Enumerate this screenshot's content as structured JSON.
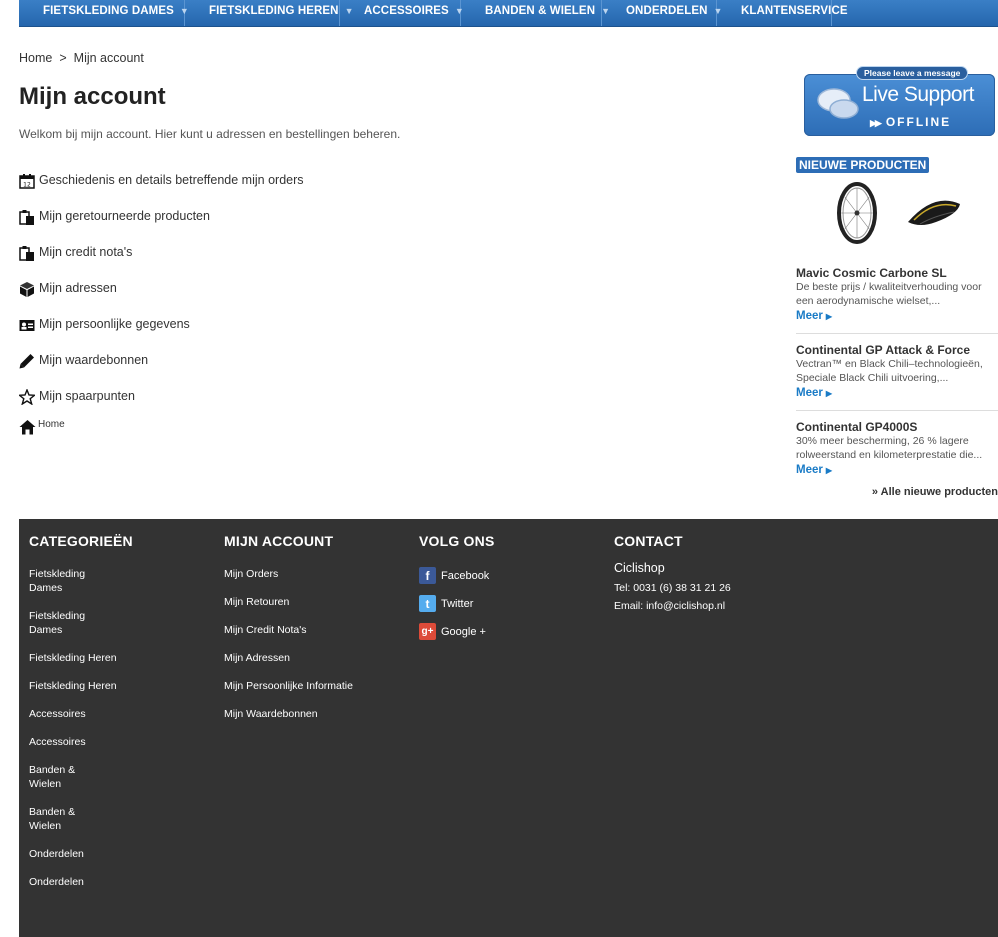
{
  "nav": {
    "items": [
      {
        "label": "FIETSKLEDING DAMES",
        "dropdown": true
      },
      {
        "label": "FIETSKLEDING HEREN",
        "dropdown": true
      },
      {
        "label": "ACCESSOIRES",
        "dropdown": true
      },
      {
        "label": "BANDEN & WIELEN",
        "dropdown": true
      },
      {
        "label": "ONDERDELEN",
        "dropdown": true
      },
      {
        "label": "KLANTENSERVICE",
        "dropdown": false
      }
    ]
  },
  "breadcrumb": {
    "home": "Home",
    "separator": ">",
    "current": "Mijn account"
  },
  "page": {
    "title": "Mijn account",
    "intro": "Welkom bij mijn account. Hier kunt u adressen en bestellingen beheren."
  },
  "account_links": [
    {
      "label": "Geschiedenis en details betreffende mijn orders",
      "icon": "calendar-icon"
    },
    {
      "label": "Mijn geretourneerde producten",
      "icon": "clipboard-icon"
    },
    {
      "label": "Mijn credit nota's",
      "icon": "clipboard-icon"
    },
    {
      "label": "Mijn adressen",
      "icon": "box-icon"
    },
    {
      "label": "Mijn persoonlijke gegevens",
      "icon": "id-card-icon"
    },
    {
      "label": "Mijn waardebonnen",
      "icon": "pencil-icon"
    },
    {
      "label": "Mijn spaarpunten",
      "icon": "star-icon"
    }
  ],
  "home_link": {
    "label": "Home",
    "icon": "home-icon"
  },
  "live_support": {
    "message": "Please leave a message",
    "title": "Live Support",
    "status": "OFFLINE"
  },
  "new_products": {
    "badge": "NIEUWE PRODUCTEN",
    "items": [
      {
        "name": "Mavic Cosmic Carbone SL",
        "desc": "De beste prijs / kwaliteitverhouding voor een aerodynamische wielset,...",
        "more": "Meer"
      },
      {
        "name": "Continental GP Attack & Force",
        "desc": "Vectran™ en Black Chili–technologieën, Speciale Black Chili uitvoering,...",
        "more": "Meer"
      },
      {
        "name": "Continental GP4000S",
        "desc": "30% meer bescherming, 26 % lagere rolweerstand en kilometerprestatie die...",
        "more": "Meer"
      }
    ],
    "all_link": "» Alle nieuwe producten"
  },
  "footer": {
    "categories": {
      "title": "CATEGORIEËN",
      "links": [
        "Fietskleding Dames",
        "Fietskleding Dames",
        "Fietskleding Heren",
        "Fietskleding Heren",
        "Accessoires",
        "Accessoires",
        "Banden & Wielen",
        "Banden & Wielen",
        "Onderdelen",
        "Onderdelen"
      ]
    },
    "account": {
      "title": "MIJN ACCOUNT",
      "links": [
        "Mijn Orders",
        "Mijn Retouren",
        "Mijn Credit Nota's",
        "Mijn Adressen",
        "Mijn Persoonlijke Informatie",
        "Mijn Waardebonnen"
      ]
    },
    "follow": {
      "title": "VOLG ONS",
      "links": [
        {
          "label": "Facebook",
          "icon": "facebook-icon",
          "color": "#3b5998",
          "glyph": "f"
        },
        {
          "label": "Twitter",
          "icon": "twitter-icon",
          "color": "#55acee",
          "glyph": "t"
        },
        {
          "label": "Google +",
          "icon": "google-plus-icon",
          "color": "#dd4b39",
          "glyph": "g+"
        }
      ]
    },
    "contact": {
      "title": "CONTACT",
      "name": "Ciclishop",
      "tel": "Tel: 0031 (6) 38 31 21 26",
      "email": "Email: info@ciclishop.nl"
    }
  },
  "colors": {
    "nav_blue": "#2d6db6",
    "link_blue": "#1a7bc6",
    "footer_bg": "#333333"
  }
}
